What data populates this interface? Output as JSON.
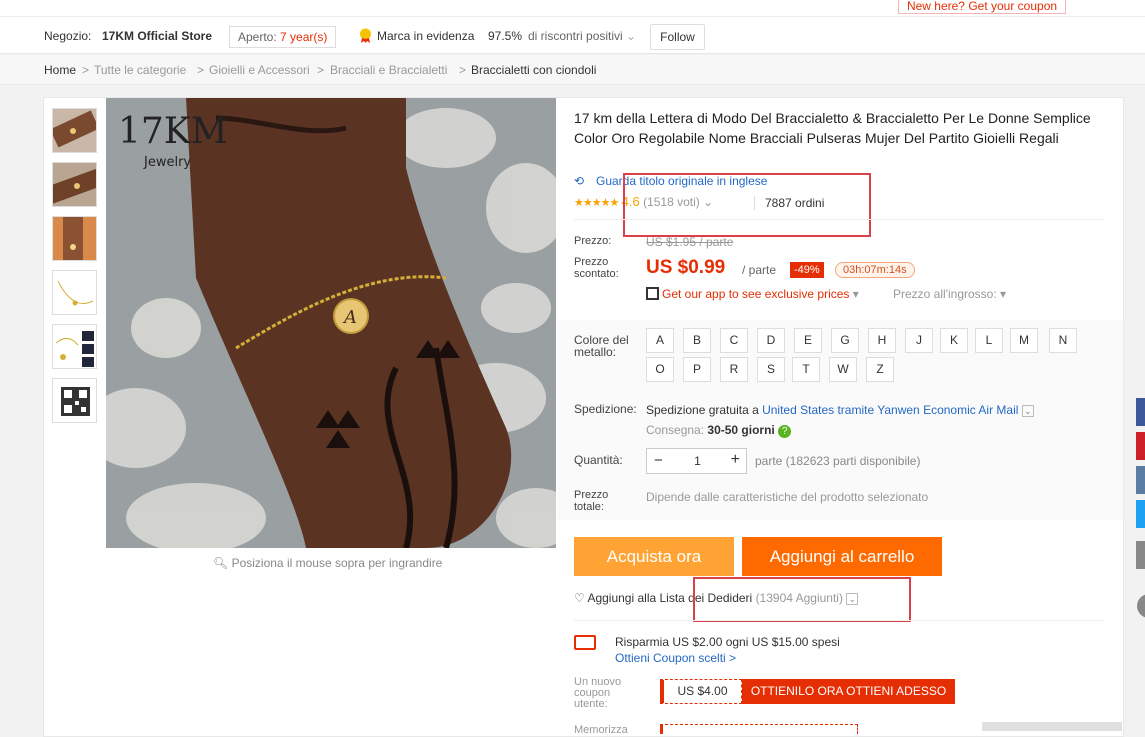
{
  "promo": {
    "text": "New here? Get your coupon"
  },
  "store": {
    "label": "Negozio:",
    "name": "17KM Official Store",
    "open_label": "Aperto:",
    "open_years": "7 year(s)",
    "brand_label": "Marca in evidenza",
    "feedback_pct": "97.5%",
    "feedback_label": "di riscontri positivi",
    "follow_label": "Follow"
  },
  "breadcrumb": {
    "items": [
      "Home",
      "Tutte le categorie",
      "Gioielli e Accessori",
      "Bracciali e Braccialetti",
      "Braccialetti con ciondoli"
    ],
    "separator": ">"
  },
  "gallery": {
    "brand_logo": "17KM",
    "brand_sub": "Jewelry",
    "zoom_hint": "Posiziona il mouse sopra per ingrandire",
    "pendant_letter": "A"
  },
  "product": {
    "title": "17 km della Lettera di Modo Del Braccialetto & Braccialetto Per Le Donne Semplice Color Oro Regolabile Nome Bracciali Pulseras Mujer Del Partito Gioielli Regali",
    "original_title_link": "Guarda titolo originale in inglese",
    "stars": "★★★★★",
    "rating": "4.6",
    "votes": "(1518 voti)",
    "orders": "7887 ordini"
  },
  "price": {
    "price_label": "Prezzo:",
    "old_price": "US $1.95 / parte",
    "discount_label": "Prezzo scontato:",
    "new_price": "US $0.99",
    "unit": "/ parte",
    "discount_pct": "-49%",
    "timer": "03h:07m:14s",
    "app_promo": "Get our app to see exclusive prices",
    "wholesale": "Prezzo all'ingrosso:"
  },
  "options": {
    "color_label": "Colore del metallo:",
    "letters_row1": [
      "A",
      "B",
      "C",
      "D",
      "E",
      "G",
      "H",
      "J",
      "K",
      "L",
      "M",
      "N"
    ],
    "letters_row2": [
      "O",
      "P",
      "R",
      "S",
      "T",
      "W",
      "Z"
    ]
  },
  "shipping": {
    "label": "Spedizione:",
    "text": "Spedizione gratuita a",
    "destination": "United States tramite Yanwen Economic Air Mail",
    "delivery_label": "Consegna:",
    "delivery_days": "30-50 giorni"
  },
  "quantity": {
    "label": "Quantità:",
    "value": "1",
    "availability": "parte (182623 parti disponibile)"
  },
  "total": {
    "label": "Prezzo totale:",
    "text": "Dipende dalle caratteristiche del prodotto selezionato"
  },
  "actions": {
    "buy_now": "Acquista ora",
    "add_to_cart": "Aggiungi al carrello",
    "wishlist": "Aggiungi alla Lista dei Dedideri",
    "wishlist_count": "(13904 Aggiunti)"
  },
  "coupons": {
    "save_text": "Risparmia US $2.00 ogni US $15.00 spesi",
    "select_link": "Ottieni Coupon scelti >",
    "new_user_label": "Un nuovo coupon utente:",
    "amount": "US $4.00",
    "get_now": "OTTIENILO ORA OTTIENI ADESSO",
    "memorize_label": "Memorizza"
  },
  "colors": {
    "accent_red": "#e62e04",
    "buy_orange": "#ffa434",
    "cart_orange": "#ff6a00",
    "link_blue": "#2468c6",
    "star_gold": "#f7a103",
    "annotation_red": "#d9404a"
  }
}
